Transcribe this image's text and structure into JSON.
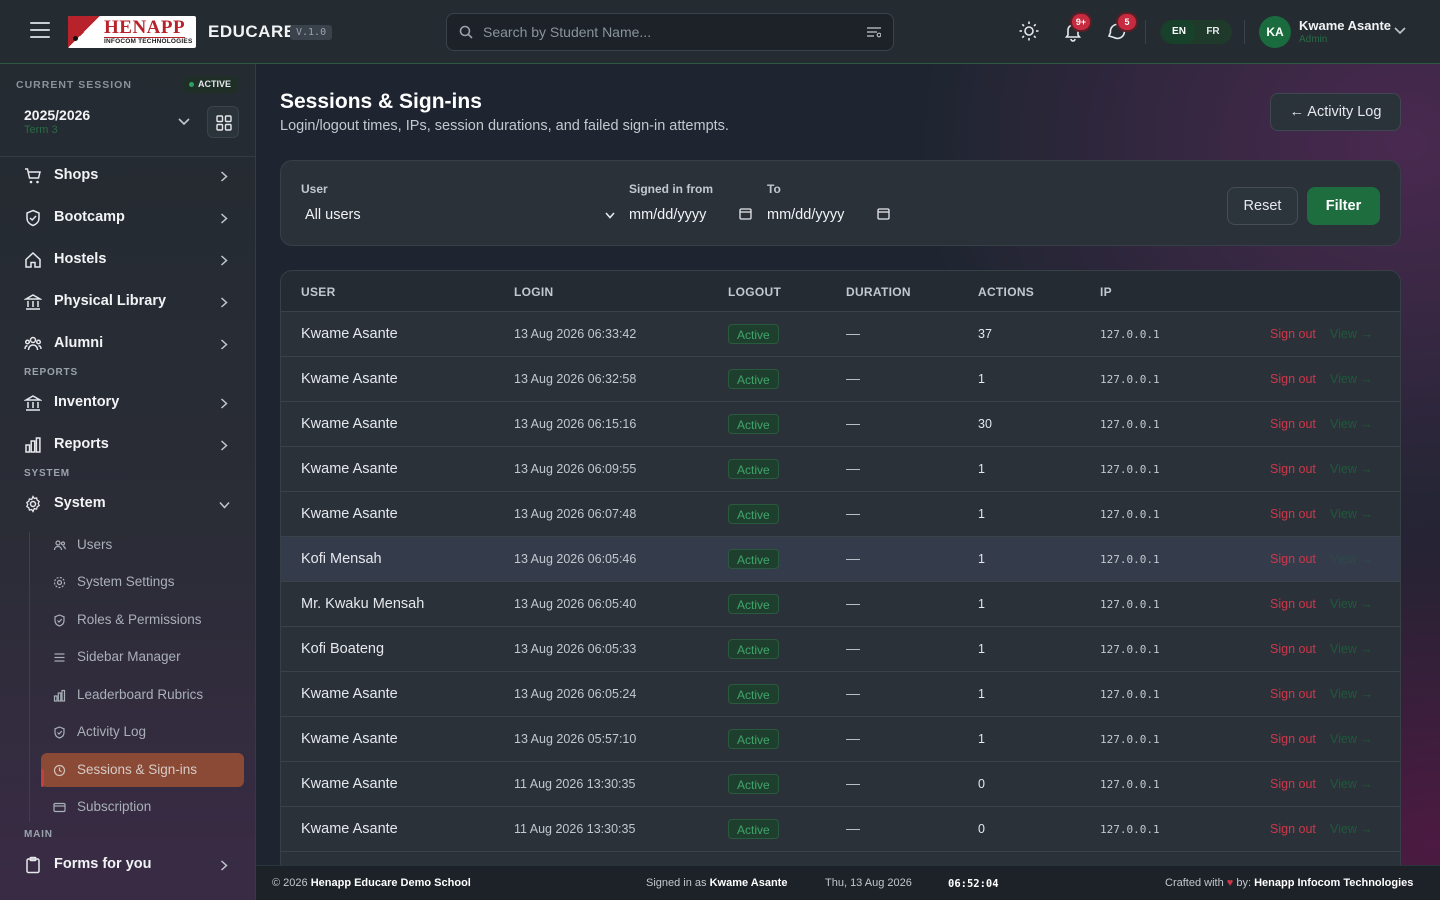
{
  "topbar": {
    "logo_main": "HENAPP",
    "logo_sub": "INFOCOM TECHNOLOGIES",
    "brand": "EDUCARE",
    "version": "V.1.0",
    "search_placeholder": "Search by Student Name...",
    "notifications_badge": "9+",
    "messages_badge": "5",
    "lang_en": "EN",
    "lang_fr": "FR",
    "avatar_initials": "KA",
    "user_name": "Kwame Asante",
    "user_role": "Admin"
  },
  "sidebar": {
    "session_label": "CURRENT SESSION",
    "session_status": "ACTIVE",
    "session_year": "2025/2026",
    "session_term": "Term 3",
    "items": {
      "shops": "Shops",
      "bootcamp": "Bootcamp",
      "hostels": "Hostels",
      "library": "Physical Library",
      "alumni": "Alumni",
      "inventory": "Inventory",
      "reports": "Reports",
      "system": "System",
      "forms": "Forms for you"
    },
    "sections": {
      "reports": "REPORTS",
      "system": "SYSTEM",
      "main": "MAIN"
    },
    "sub_items": {
      "users": "Users",
      "settings": "System Settings",
      "roles": "Roles & Permissions",
      "sidebar_manager": "Sidebar Manager",
      "leaderboard": "Leaderboard Rubrics",
      "activity_log": "Activity Log",
      "sessions": "Sessions & Sign-ins",
      "subscription": "Subscription"
    }
  },
  "main": {
    "title": "Sessions & Sign-ins",
    "subtitle": "Login/logout times, IPs, session durations, and failed sign-in attempts.",
    "back_button": "← Activity Log",
    "filters": {
      "user_label": "User",
      "user_value": "All users",
      "from_label": "Signed in from",
      "from_value": "mm/dd/yyyy",
      "to_label": "To",
      "to_value": "mm/dd/yyyy",
      "reset": "Reset",
      "filter": "Filter"
    },
    "table": {
      "headers": [
        "USER",
        "LOGIN",
        "LOGOUT",
        "DURATION",
        "ACTIONS",
        "IP"
      ],
      "sign_out_label": "Sign out",
      "view_label": "View →",
      "rows": [
        {
          "user": "Kwame Asante",
          "login": "13 Aug 2026 06:33:42",
          "logout": "Active",
          "duration": "—",
          "actions": "37",
          "ip": "127.0.0.1"
        },
        {
          "user": "Kwame Asante",
          "login": "13 Aug 2026 06:32:58",
          "logout": "Active",
          "duration": "—",
          "actions": "1",
          "ip": "127.0.0.1"
        },
        {
          "user": "Kwame Asante",
          "login": "13 Aug 2026 06:15:16",
          "logout": "Active",
          "duration": "—",
          "actions": "30",
          "ip": "127.0.0.1"
        },
        {
          "user": "Kwame Asante",
          "login": "13 Aug 2026 06:09:55",
          "logout": "Active",
          "duration": "—",
          "actions": "1",
          "ip": "127.0.0.1"
        },
        {
          "user": "Kwame Asante",
          "login": "13 Aug 2026 06:07:48",
          "logout": "Active",
          "duration": "—",
          "actions": "1",
          "ip": "127.0.0.1"
        },
        {
          "user": "Kofi Mensah",
          "login": "13 Aug 2026 06:05:46",
          "logout": "Active",
          "duration": "—",
          "actions": "1",
          "ip": "127.0.0.1"
        },
        {
          "user": "Mr. Kwaku Mensah",
          "login": "13 Aug 2026 06:05:40",
          "logout": "Active",
          "duration": "—",
          "actions": "1",
          "ip": "127.0.0.1"
        },
        {
          "user": "Kofi Boateng",
          "login": "13 Aug 2026 06:05:33",
          "logout": "Active",
          "duration": "—",
          "actions": "1",
          "ip": "127.0.0.1"
        },
        {
          "user": "Kwame Asante",
          "login": "13 Aug 2026 06:05:24",
          "logout": "Active",
          "duration": "—",
          "actions": "1",
          "ip": "127.0.0.1"
        },
        {
          "user": "Kwame Asante",
          "login": "13 Aug 2026 05:57:10",
          "logout": "Active",
          "duration": "—",
          "actions": "1",
          "ip": "127.0.0.1"
        },
        {
          "user": "Kwame Asante",
          "login": "11 Aug 2026 13:30:35",
          "logout": "Active",
          "duration": "—",
          "actions": "0",
          "ip": "127.0.0.1"
        },
        {
          "user": "Kwame Asante",
          "login": "11 Aug 2026 13:30:35",
          "logout": "Active",
          "duration": "—",
          "actions": "0",
          "ip": "127.0.0.1"
        }
      ]
    }
  },
  "footer": {
    "copyright_prefix": "© 2026",
    "school": "Henapp Educare Demo School",
    "signed_in_prefix": "Signed in as",
    "signed_in_user": "Kwame Asante",
    "date": "Thu, 13 Aug 2026",
    "time": "06:52:04",
    "crafted_prefix": "Crafted with",
    "crafted_by": "by:",
    "company": "Henapp Infocom Technologies"
  },
  "colors": {
    "accent_green": "#1e6d3e",
    "danger": "#d0364a",
    "active_nav": "#8a4a36"
  }
}
